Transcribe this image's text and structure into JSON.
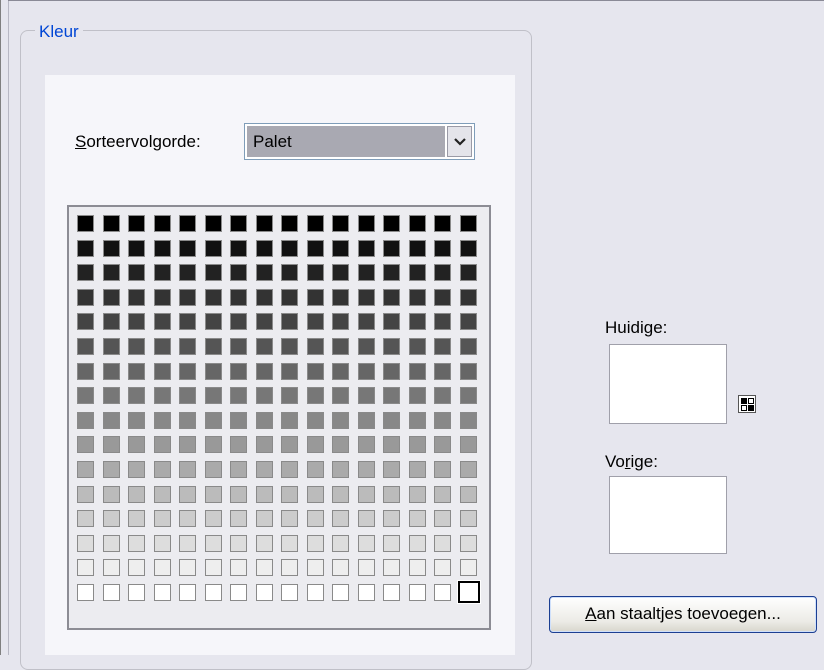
{
  "group": {
    "title": "Kleur"
  },
  "sort": {
    "label_prefix": "S",
    "label_rest": "orteervolgorde:",
    "selected": "Palet"
  },
  "palette": {
    "columns": 16,
    "rows": 16,
    "row_colors": [
      "#000000",
      "#111111",
      "#222222",
      "#333333",
      "#444444",
      "#555555",
      "#666666",
      "#777777",
      "#888888",
      "#999999",
      "#aaaaaa",
      "#bbbbbb",
      "#cccccc",
      "#dddddd",
      "#eeeeee",
      "#ffffff"
    ],
    "selected_row": 15,
    "selected_col": 15
  },
  "current": {
    "label": "Huidige:"
  },
  "previous": {
    "label_a": "Vo",
    "label_u": "r",
    "label_b": "ige:"
  },
  "add_button": {
    "label_u": "A",
    "label_rest": "an staaltjes toevoegen..."
  }
}
